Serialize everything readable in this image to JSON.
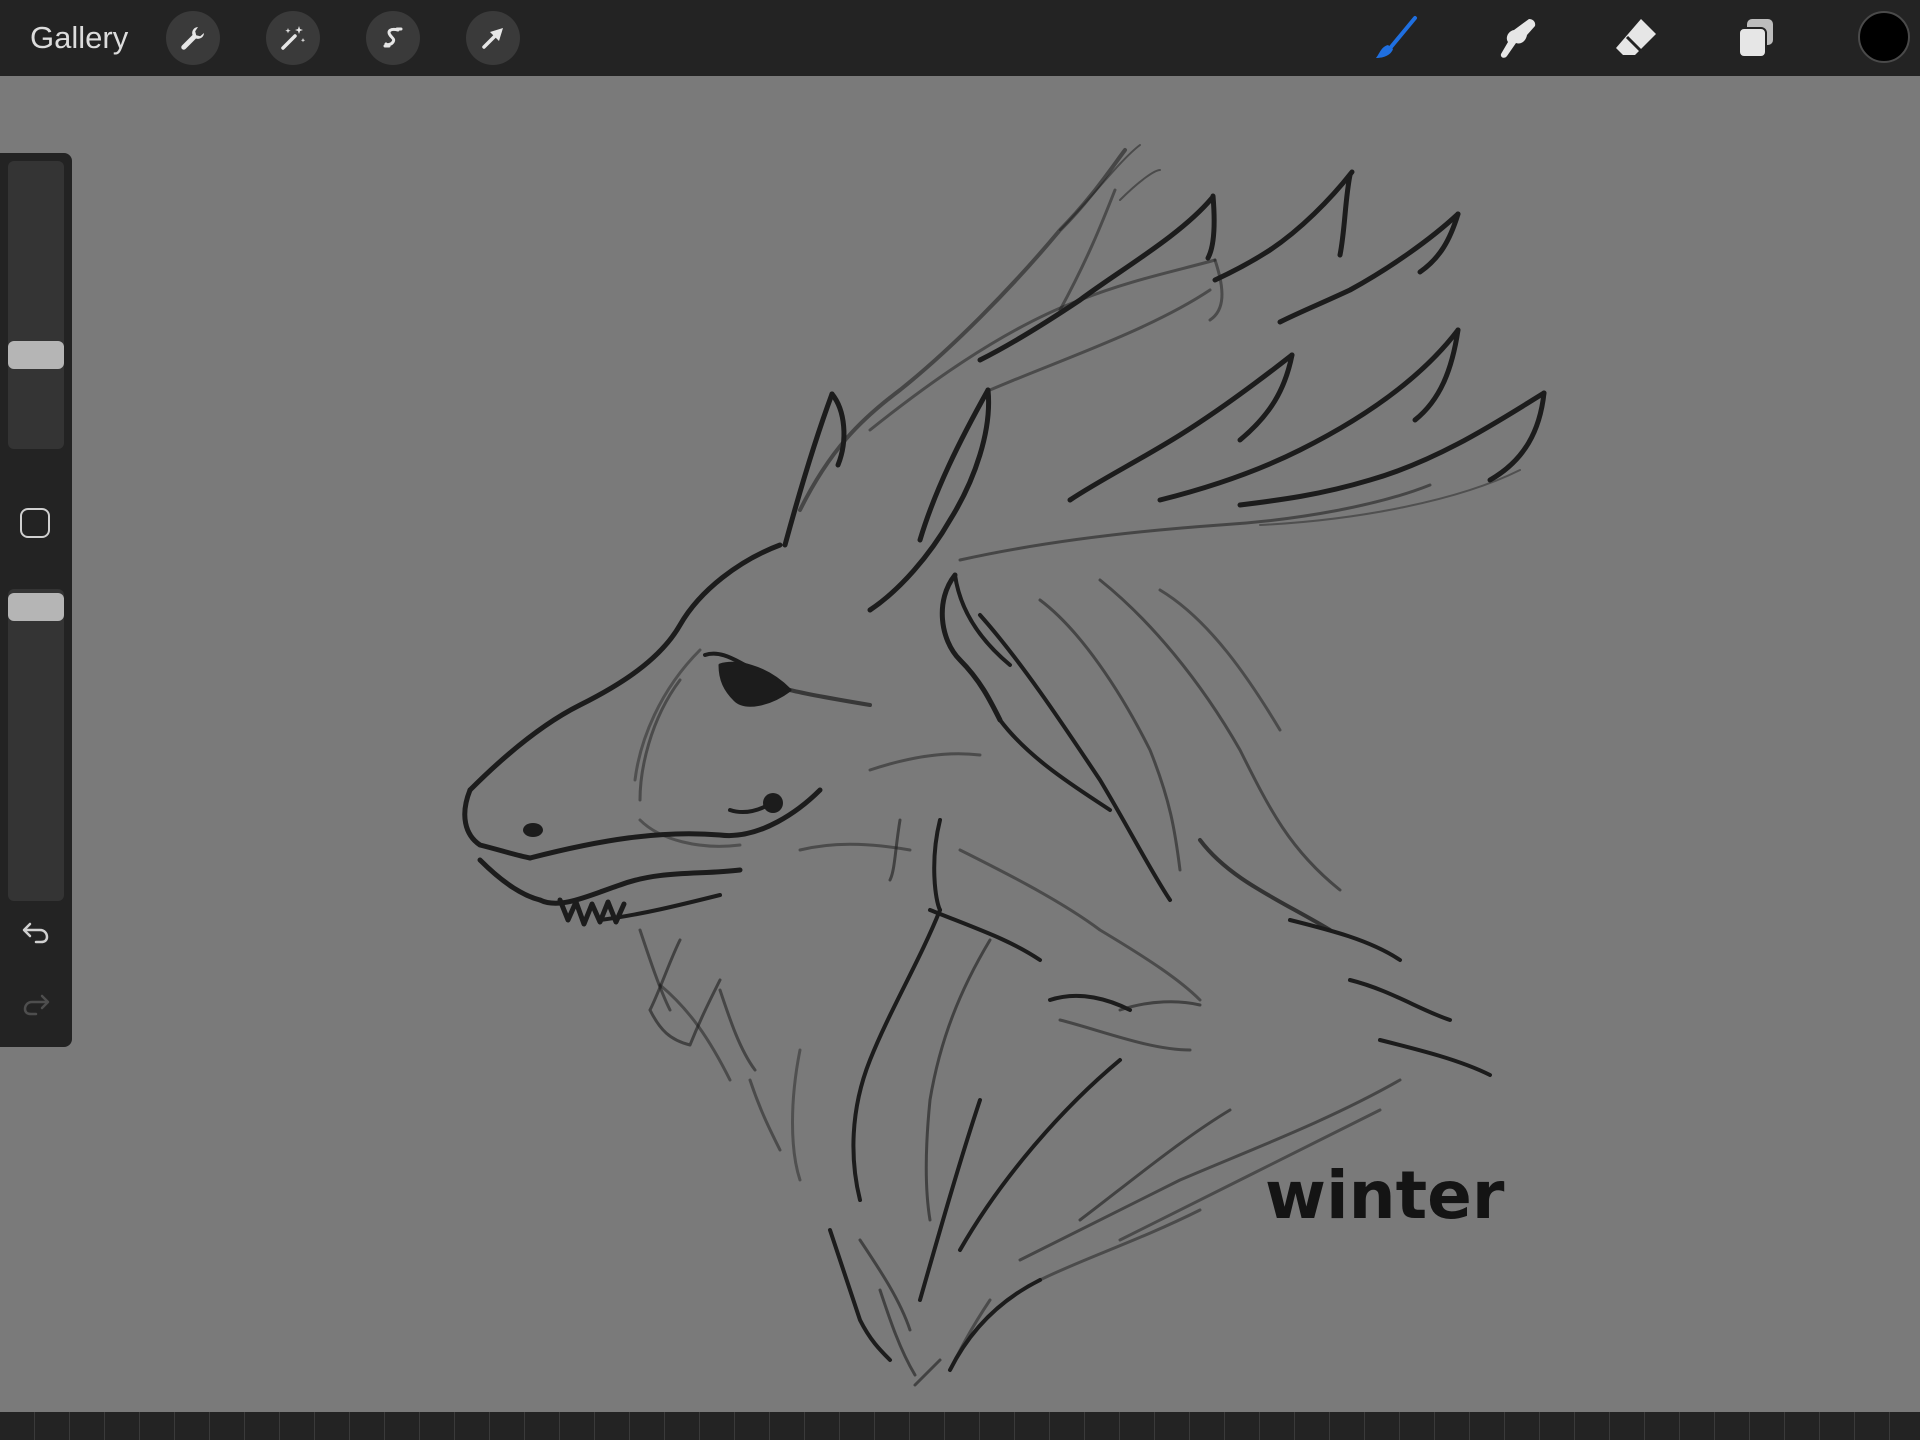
{
  "topbar": {
    "gallery_label": "Gallery",
    "left_tools": [
      "wrench-icon",
      "magic-wand-icon",
      "selection-icon",
      "transform-arrow-icon"
    ],
    "right_tools": [
      "brush-icon",
      "smudge-icon",
      "eraser-icon",
      "layers-icon"
    ],
    "active_tool": "brush-icon",
    "active_color": "#1f6fe0",
    "current_color": "#000000"
  },
  "sidebar": {
    "brush_size_level": 0.36,
    "opacity_level": 0.96,
    "icons": [
      "modify-square-icon",
      "undo-icon",
      "redo-icon"
    ]
  },
  "canvas": {
    "background_color": "#7a7a7a",
    "signature_text": "winter"
  }
}
